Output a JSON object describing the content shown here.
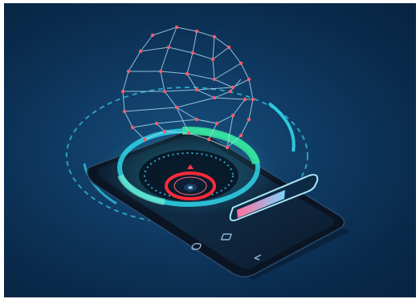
{
  "illustration": {
    "subject": "smartphone-face-scan",
    "colors": {
      "background_center": "#17507e",
      "background_edge": "#082341",
      "wireframe_lines": "#a9d8ef",
      "wireframe_nodes": "#ff5a6a",
      "scan_ring_cyan": "#2fd6ea",
      "scan_ring_green": "#36e29a",
      "target_red": "#ff2a3a",
      "phone_body": "#0b1422",
      "slider_gradient_start": "#ff6f9a",
      "slider_gradient_end": "#7fd3ff"
    },
    "icons": [
      "back-icon",
      "home-icon",
      "recent-apps-icon",
      "shield-icon"
    ]
  }
}
